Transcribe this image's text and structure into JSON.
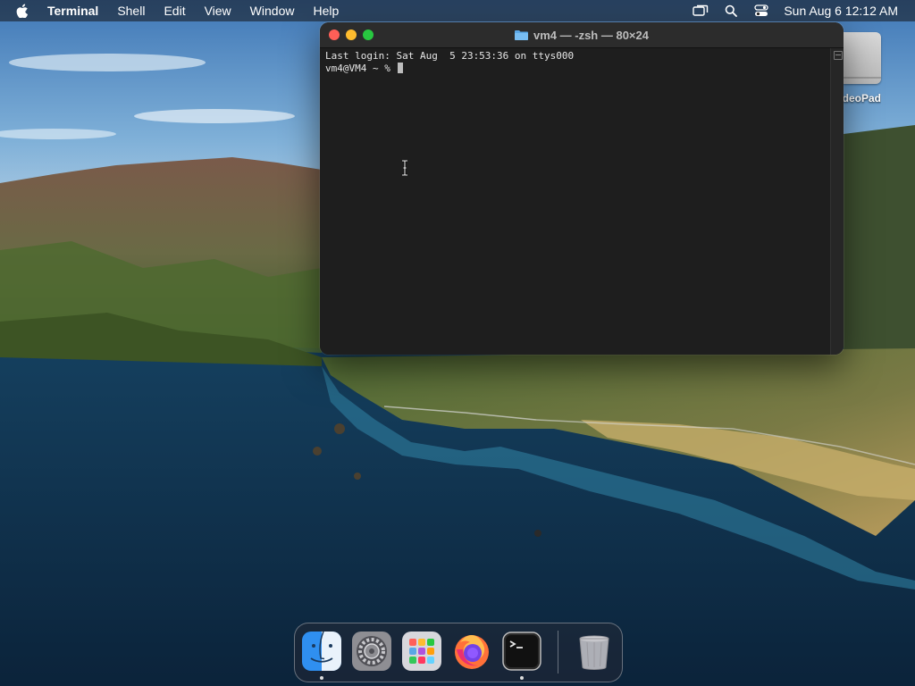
{
  "menubar": {
    "app_name": "Terminal",
    "menus": [
      "Shell",
      "Edit",
      "View",
      "Window",
      "Help"
    ],
    "status_icons": [
      "screen-mirroring-icon",
      "spotlight-search-icon",
      "control-center-icon"
    ],
    "clock": "Sun Aug 6  12:12 AM"
  },
  "desktop": {
    "drive_label": "VideoPad"
  },
  "terminal": {
    "title": "vm4 — -zsh — 80×24",
    "lines": [
      "Last login: Sat Aug  5 23:53:36 on ttys000",
      "vm4@VM4 ~ % "
    ]
  },
  "dock": {
    "apps": [
      "Finder",
      "System Preferences",
      "Launchpad",
      "Firefox",
      "Terminal",
      "Trash"
    ],
    "running": [
      "Finder",
      "Terminal"
    ]
  },
  "colors": {
    "close": "#fe5f57",
    "minimize": "#febc2e",
    "maximize": "#28c840",
    "terminal_bg": "#1e1e1e"
  }
}
